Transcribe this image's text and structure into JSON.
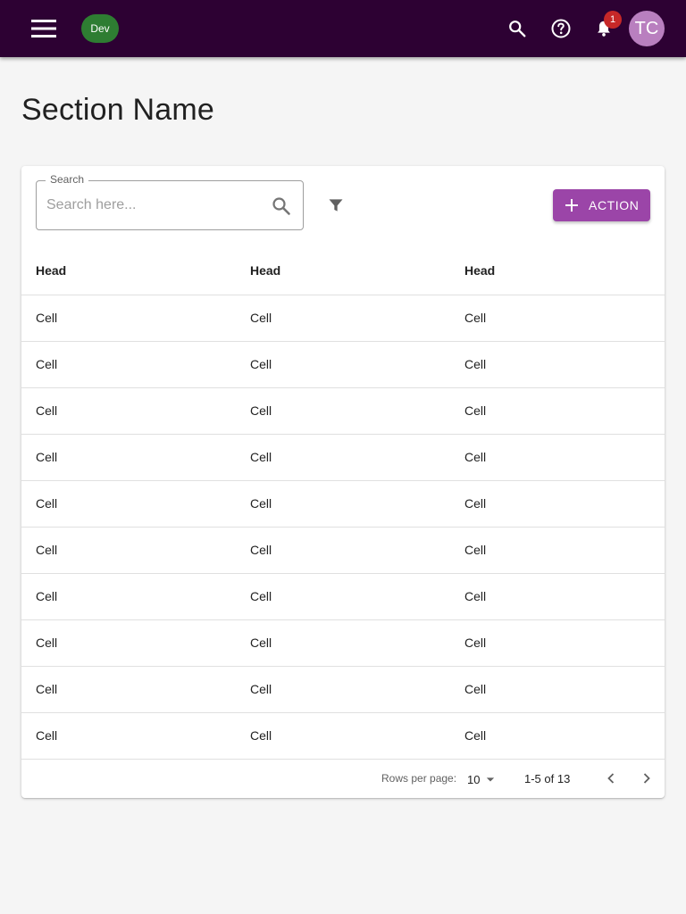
{
  "appbar": {
    "env_badge": "Dev",
    "notification_count": "1",
    "avatar_initials": "TC",
    "icons": [
      "menu-icon",
      "search-icon",
      "help-icon",
      "bell-icon"
    ],
    "bg_color": "#2d0133"
  },
  "page": {
    "title": "Section Name"
  },
  "toolbar": {
    "search_label": "Search",
    "search_placeholder": "Search here...",
    "action_label": "ACTION",
    "action_color": "#9b45a8"
  },
  "table": {
    "headers": [
      "Head",
      "Head",
      "Head"
    ],
    "rows": [
      [
        "Cell",
        "Cell",
        "Cell"
      ],
      [
        "Cell",
        "Cell",
        "Cell"
      ],
      [
        "Cell",
        "Cell",
        "Cell"
      ],
      [
        "Cell",
        "Cell",
        "Cell"
      ],
      [
        "Cell",
        "Cell",
        "Cell"
      ],
      [
        "Cell",
        "Cell",
        "Cell"
      ],
      [
        "Cell",
        "Cell",
        "Cell"
      ],
      [
        "Cell",
        "Cell",
        "Cell"
      ],
      [
        "Cell",
        "Cell",
        "Cell"
      ],
      [
        "Cell",
        "Cell",
        "Cell"
      ]
    ]
  },
  "pagination": {
    "rows_per_page_label": "Rows per page:",
    "rows_per_page_value": "10",
    "range_text": "1-5 of 13"
  }
}
